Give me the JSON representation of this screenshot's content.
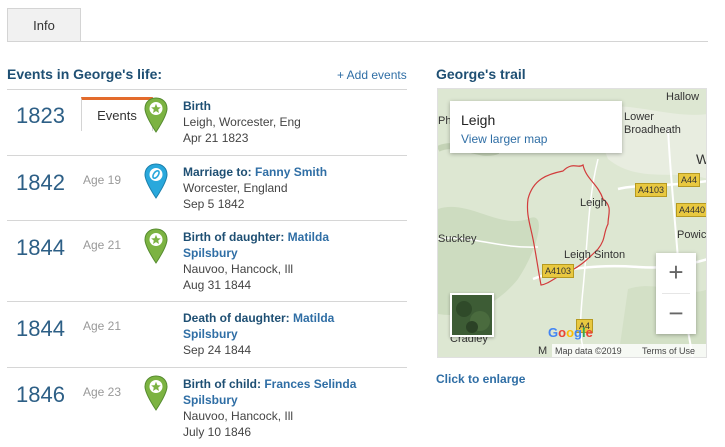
{
  "tabs": [
    {
      "label": "Info"
    },
    {
      "label": "Events"
    }
  ],
  "events_section": {
    "title": "Events in George's life:",
    "add_label": "+ Add events",
    "items": [
      {
        "year": "1823",
        "age": "",
        "title": "Birth",
        "link": "",
        "link2": "",
        "place": "Leigh, Worcester, Eng",
        "date": "Apr 21 1823",
        "icon": "birth-pin-icon"
      },
      {
        "year": "1842",
        "age": "Age 19",
        "title": "Marriage to:",
        "link": "Fanny Smith",
        "link2": "",
        "place": "Worcester, England",
        "date": "Sep 5 1842",
        "icon": "marriage-pin-icon"
      },
      {
        "year": "1844",
        "age": "Age 21",
        "title": "Birth of daughter:",
        "link": "Matilda",
        "link2": "Spilsbury",
        "place": "Nauvoo, Hancock, Ill",
        "date": "Aug 31 1844",
        "icon": "birth-pin-icon"
      },
      {
        "year": "1844",
        "age": "Age 21",
        "title": "Death of daughter:",
        "link": "Matilda",
        "link2": "Spilsbury",
        "place": "",
        "date": "Sep 24 1844",
        "icon": ""
      },
      {
        "year": "1846",
        "age": "Age 23",
        "title": "Birth of child:",
        "link": "Frances Selinda",
        "link2": "Spilsbury",
        "place": "Nauvoo, Hancock, Ill",
        "date": "July 10 1846",
        "icon": "birth-pin-icon"
      }
    ]
  },
  "trail": {
    "title": "George's trail",
    "infobox_place": "Leigh",
    "infobox_link": "View larger map",
    "labels": {
      "hallow": "Hallow",
      "lower": "Lower",
      "broadheath": "Broadheath",
      "phi": "Phi",
      "leigh": "Leigh",
      "suckley": "Suckley",
      "leigh_sinton": "Leigh Sinton",
      "powic": "Powic",
      "w": "W",
      "cradley": "Cradley",
      "m": "M"
    },
    "roads": {
      "a4103_top": "A4103",
      "a44": "A44",
      "a4440": "A4440",
      "a4103_bottom": "A4103",
      "a449": "A4"
    },
    "zoom_in": "+",
    "zoom_out": "−",
    "google": "Google",
    "map_data": "Map data ©2019",
    "terms": "Terms of Use",
    "enlarge": "Click to enlarge"
  },
  "colors": {
    "accent": "#e36b2c",
    "link": "#2f6ea5",
    "heading": "#1e4f73",
    "pin_green": "#7cb342",
    "pin_blue": "#29a8dc",
    "trail_red": "#d23c3c"
  }
}
